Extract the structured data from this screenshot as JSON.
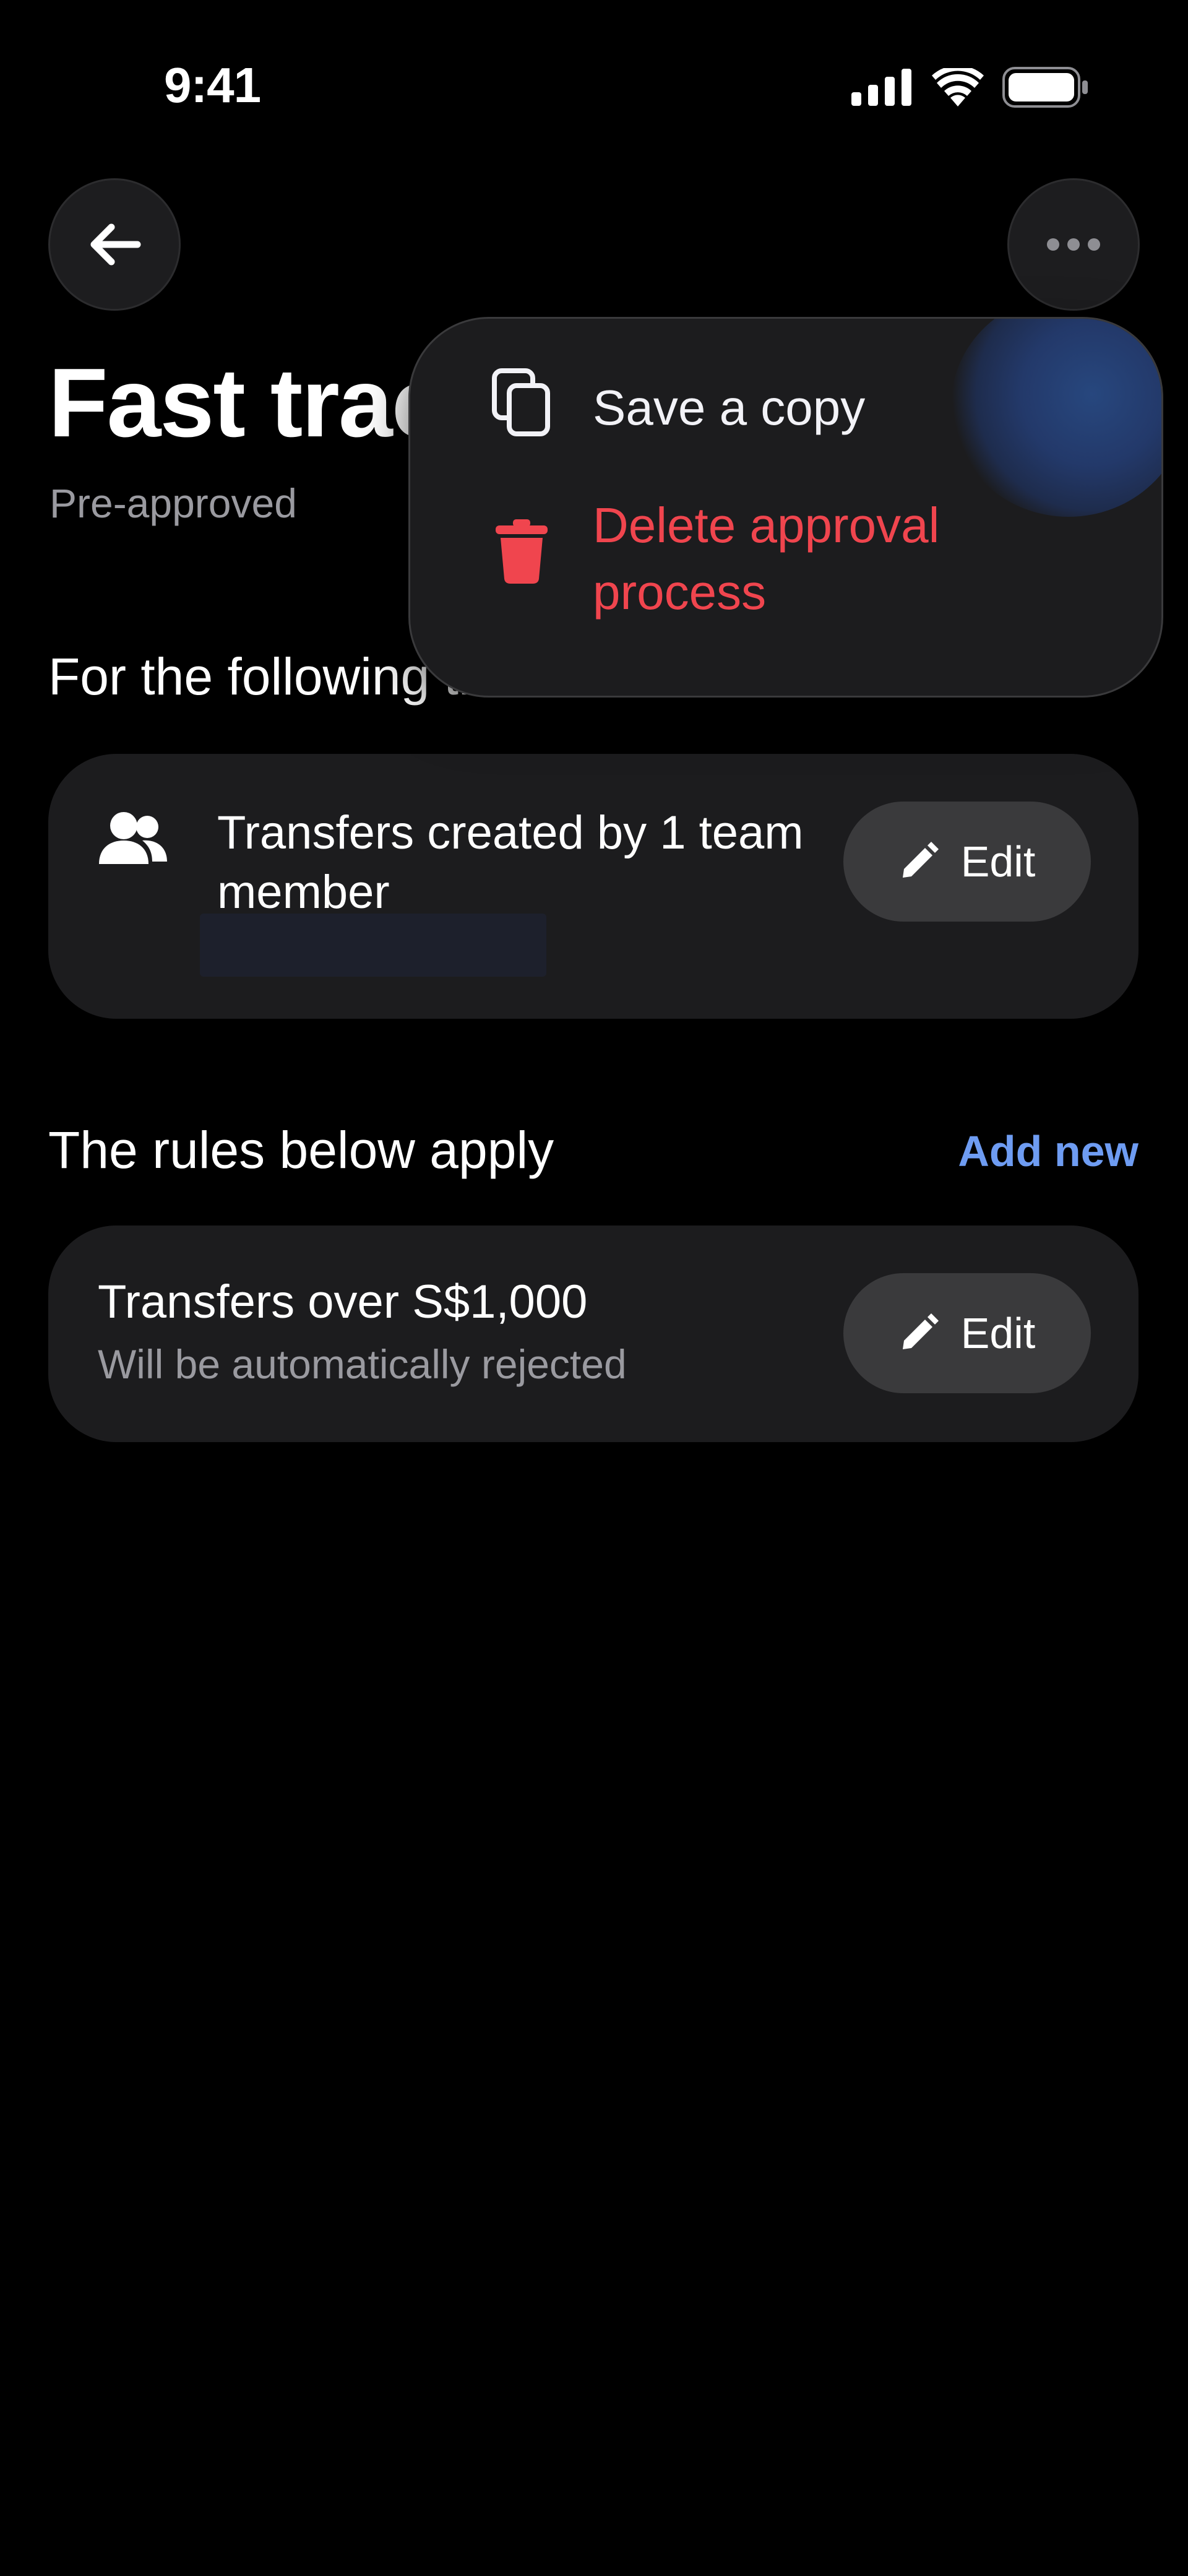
{
  "status_bar": {
    "time": "9:41",
    "icons": [
      "signal-icon",
      "wifi-icon",
      "battery-icon"
    ]
  },
  "header": {
    "back_icon": "arrow-left-icon",
    "more_icon": "ellipsis-icon",
    "title": "Fast track",
    "subtitle": "Pre-approved"
  },
  "menu": {
    "items": [
      {
        "label": "Save a copy",
        "icon": "copy-icon",
        "color": "#f2f2f7"
      },
      {
        "label": "Delete approval process",
        "icon": "trash-icon",
        "color": "#f0454e"
      }
    ]
  },
  "transfers_section": {
    "title": "For the following transfers",
    "card": {
      "icon": "team-icon",
      "text": "Transfers created by 1 team member",
      "edit_label": "Edit",
      "edit_icon": "pencil-icon"
    }
  },
  "rules_section": {
    "title": "The rules below apply",
    "add_new_label": "Add new",
    "rules": [
      {
        "title": "Transfers over S$1,000",
        "description": "Will be automatically rejected",
        "edit_label": "Edit",
        "edit_icon": "pencil-icon"
      }
    ]
  },
  "colors": {
    "background": "#000000",
    "card": "#1c1c1e",
    "accent_link": "#6e9cf2",
    "danger": "#f0454e",
    "muted_text": "#9a9aa0"
  }
}
